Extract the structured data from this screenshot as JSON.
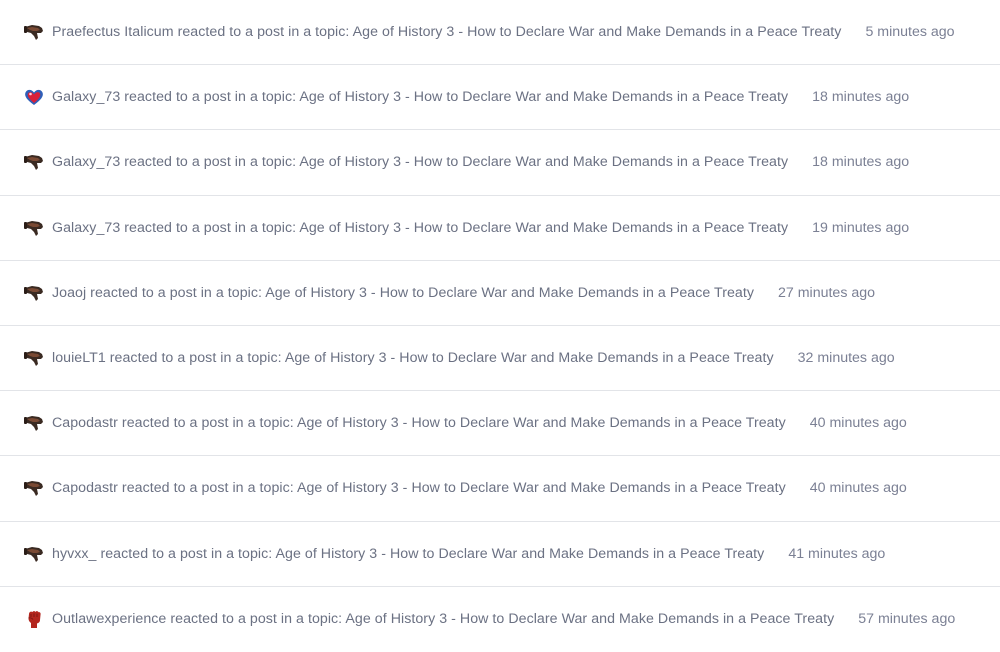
{
  "activity": {
    "items": [
      {
        "user": "Praefectus Italicum",
        "action": "reacted to a post in a topic:",
        "topic": "Age of History 3 - How to Declare War and Make Demands in a Peace Treaty",
        "time": "5 minutes ago",
        "reaction_icon": "thumbs-down-icon"
      },
      {
        "user": "Galaxy_73",
        "action": "reacted to a post in a topic:",
        "topic": "Age of History 3 - How to Declare War and Make Demands in a Peace Treaty",
        "time": "18 minutes ago",
        "reaction_icon": "heart-icon"
      },
      {
        "user": "Galaxy_73",
        "action": "reacted to a post in a topic:",
        "topic": "Age of History 3 - How to Declare War and Make Demands in a Peace Treaty",
        "time": "18 minutes ago",
        "reaction_icon": "thumbs-down-icon"
      },
      {
        "user": "Galaxy_73",
        "action": "reacted to a post in a topic:",
        "topic": "Age of History 3 - How to Declare War and Make Demands in a Peace Treaty",
        "time": "19 minutes ago",
        "reaction_icon": "thumbs-down-icon"
      },
      {
        "user": "Joaoj",
        "action": "reacted to a post in a topic:",
        "topic": "Age of History 3 - How to Declare War and Make Demands in a Peace Treaty",
        "time": "27 minutes ago",
        "reaction_icon": "thumbs-down-icon"
      },
      {
        "user": "louieLT1",
        "action": "reacted to a post in a topic:",
        "topic": "Age of History 3 - How to Declare War and Make Demands in a Peace Treaty",
        "time": "32 minutes ago",
        "reaction_icon": "thumbs-down-icon"
      },
      {
        "user": "Capodastr",
        "action": "reacted to a post in a topic:",
        "topic": "Age of History 3 - How to Declare War and Make Demands in a Peace Treaty",
        "time": "40 minutes ago",
        "reaction_icon": "thumbs-down-icon"
      },
      {
        "user": "Capodastr",
        "action": "reacted to a post in a topic:",
        "topic": "Age of History 3 - How to Declare War and Make Demands in a Peace Treaty",
        "time": "40 minutes ago",
        "reaction_icon": "thumbs-down-icon"
      },
      {
        "user": "hyvxx_",
        "action": "reacted to a post in a topic:",
        "topic": "Age of History 3 - How to Declare War and Make Demands in a Peace Treaty",
        "time": "41 minutes ago",
        "reaction_icon": "thumbs-down-icon"
      },
      {
        "user": "Outlawexperience",
        "action": "reacted to a post in a topic:",
        "topic": "Age of History 3 - How to Declare War and Make Demands in a Peace Treaty",
        "time": "57 minutes ago",
        "reaction_icon": "raised-fist-icon"
      }
    ]
  },
  "colors": {
    "text": "#6b7183",
    "divider": "#e2e4e8",
    "thumb_dark": "#3a2a22",
    "thumb_mid": "#7a4a34",
    "heart_red": "#d81f3a",
    "heart_blue": "#2f5fb8",
    "fist_red": "#b3261e"
  }
}
